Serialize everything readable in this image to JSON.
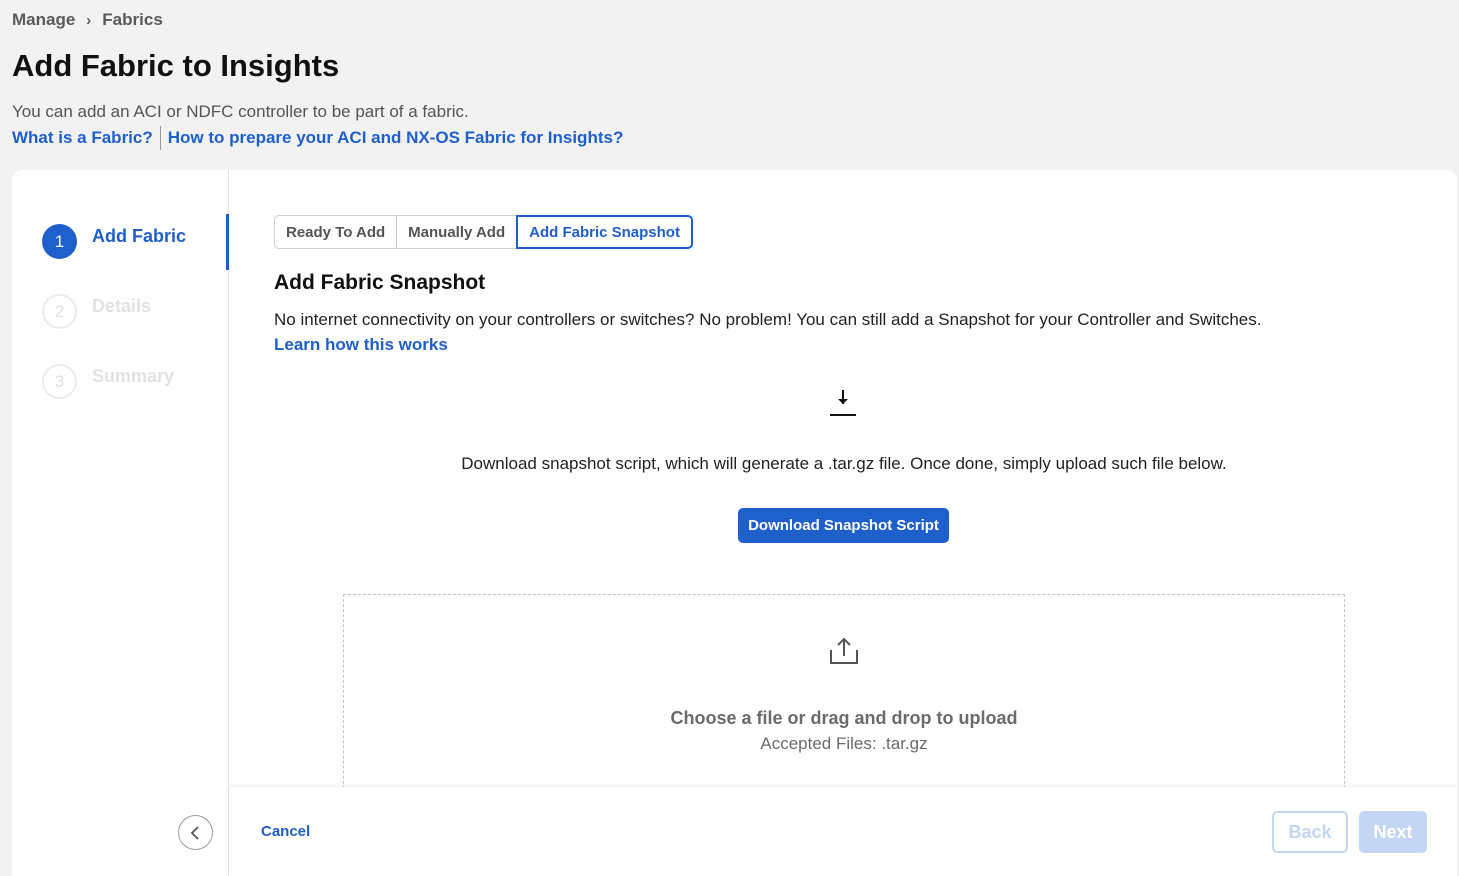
{
  "breadcrumb": {
    "items": [
      "Manage",
      "Fabrics"
    ],
    "separator": "›"
  },
  "page": {
    "title": "Add Fabric to Insights",
    "description": "You can add an ACI or NDFC controller to be part of a fabric.",
    "links": [
      "What is a Fabric?",
      "How to prepare your ACI and NX-OS Fabric for Insights?"
    ]
  },
  "steps": [
    {
      "number": "1",
      "label": "Add Fabric",
      "state": "active"
    },
    {
      "number": "2",
      "label": "Details",
      "state": "pending"
    },
    {
      "number": "3",
      "label": "Summary",
      "state": "pending"
    }
  ],
  "tabs": [
    {
      "label": "Ready To Add",
      "selected": false
    },
    {
      "label": "Manually Add",
      "selected": false
    },
    {
      "label": "Add Fabric Snapshot",
      "selected": true
    }
  ],
  "section": {
    "title": "Add Fabric Snapshot",
    "description": "No internet connectivity on your controllers or switches? No problem! You can still add a Snapshot for your Controller and Switches.",
    "learn_link": "Learn how this works"
  },
  "download": {
    "icon": "download-icon",
    "description": "Download snapshot script, which will generate a .tar.gz file. Once done, simply upload such file below.",
    "button_label": "Download Snapshot Script"
  },
  "upload": {
    "icon": "upload-icon",
    "main_text": "Choose a file or drag and drop to upload",
    "accepted_files": "Accepted Files: .tar.gz"
  },
  "footer": {
    "cancel_label": "Cancel",
    "back_label": "Back",
    "next_label": "Next"
  },
  "colors": {
    "accent": "#1f5fcc",
    "disabled": "#c3d6f3",
    "background": "#f2f2f2"
  }
}
